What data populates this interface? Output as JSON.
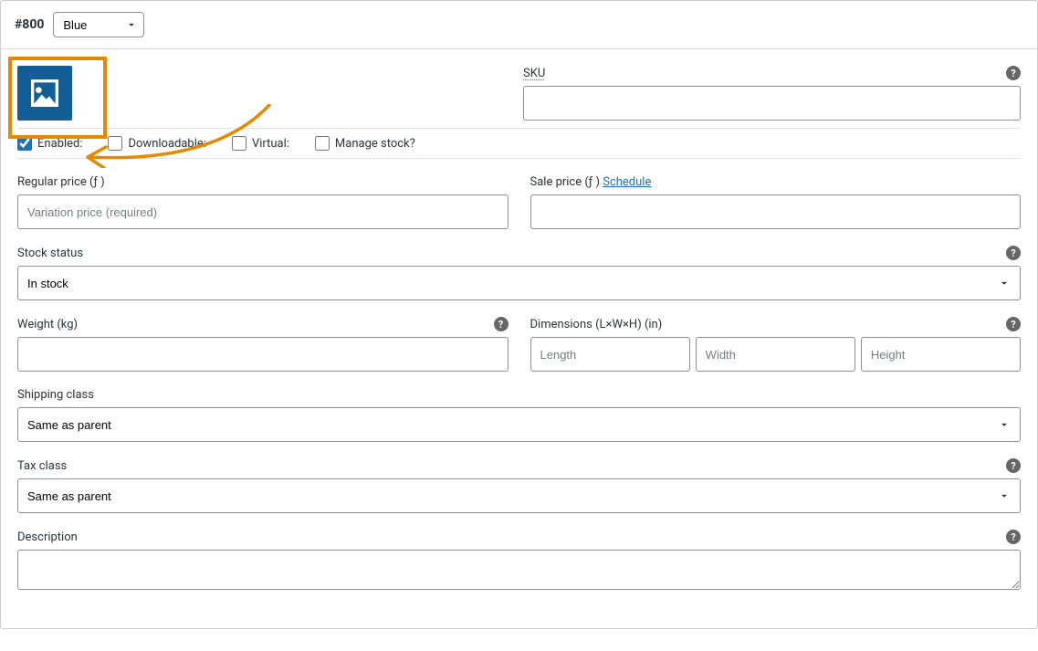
{
  "header": {
    "variation_id": "#800",
    "attribute_value": "Blue"
  },
  "sku": {
    "label": "SKU"
  },
  "checkboxes": {
    "enabled_label": "Enabled:",
    "downloadable_label": "Downloadable:",
    "virtual_label": "Virtual:",
    "manage_stock_label": "Manage stock?"
  },
  "pricing": {
    "regular_label": "Regular price (ƒ )",
    "regular_placeholder": "Variation price (required)",
    "sale_label": "Sale price (ƒ )",
    "schedule_label": "Schedule"
  },
  "stock": {
    "label": "Stock status",
    "value": "In stock"
  },
  "weight": {
    "label": "Weight (kg)"
  },
  "dimensions": {
    "label": "Dimensions (L×W×H) (in)",
    "length_placeholder": "Length",
    "width_placeholder": "Width",
    "height_placeholder": "Height"
  },
  "shipping_class": {
    "label": "Shipping class",
    "value": "Same as parent"
  },
  "tax_class": {
    "label": "Tax class",
    "value": "Same as parent"
  },
  "description": {
    "label": "Description"
  }
}
